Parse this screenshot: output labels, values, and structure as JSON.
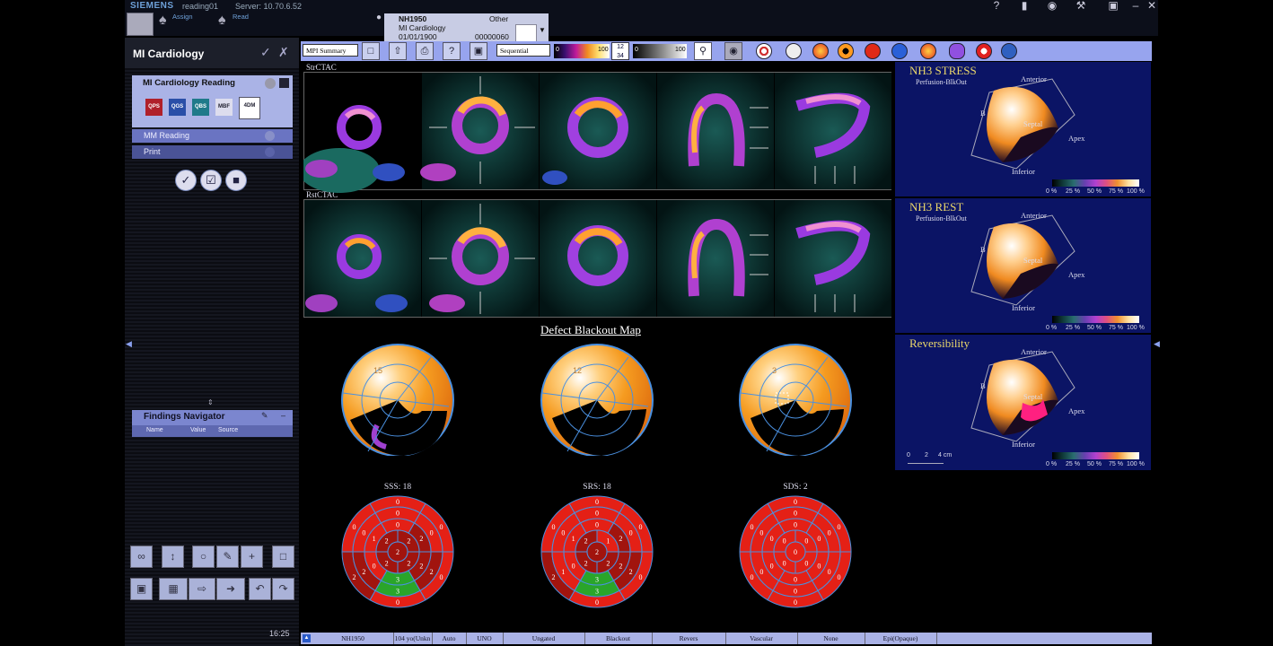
{
  "topbar": {
    "brand": "SIEMENS",
    "user": "reading01",
    "server": "Server: 10.70.6.52",
    "assign": "Assign",
    "read": "Read",
    "patient": {
      "id": "NH1950",
      "type": "Other",
      "workflow": "MI Cardiology",
      "dob": "01/01/1900",
      "number": "00000060"
    }
  },
  "left": {
    "title": "MI Cardiology",
    "task": {
      "label": "MI Cardiology Reading",
      "apps": [
        "QPS",
        "QGS",
        "QBS",
        "MBF",
        "4DM"
      ]
    },
    "rows": [
      "MM Reading",
      "Print"
    ],
    "findings": {
      "title": "Findings Navigator",
      "columns": [
        "Name",
        "Value",
        "Source"
      ]
    },
    "clock": "16:25"
  },
  "toolbar": {
    "layout_select": "MPI Summary",
    "colormap_select": "Sequential",
    "frames": [
      "1",
      "2",
      "3",
      "4"
    ],
    "scale1_min": "0",
    "scale1_max": "100",
    "scale2_min": "0",
    "scale2_max": "100"
  },
  "views": {
    "stress_label": "StrCTAC",
    "rest_label": "RstCTAC",
    "blackout_title": "Defect Blackout Map"
  },
  "blackout_scores": [
    "15",
    "12",
    "3"
  ],
  "scores": {
    "sss": "SSS: 18",
    "srs": "SRS: 18",
    "sds": "SDS: 2"
  },
  "polar_maps": [
    {
      "apex": "2",
      "inner": [
        "2",
        "2",
        "2",
        "2"
      ],
      "mid": [
        "0",
        "2",
        "2",
        "3",
        "0",
        "1"
      ],
      "basal": [
        "0",
        "0",
        "2",
        "3",
        "2",
        "0"
      ],
      "outer": [
        "0",
        "0",
        "0",
        "0",
        "2",
        "0"
      ]
    },
    {
      "apex": "2",
      "inner": [
        "1",
        "2",
        "2",
        "2"
      ],
      "mid": [
        "0",
        "2",
        "2",
        "3",
        "0",
        "1"
      ],
      "basal": [
        "0",
        "0",
        "2",
        "3",
        "1",
        "0"
      ],
      "outer": [
        "0",
        "0",
        "0",
        "0",
        "2",
        "0"
      ]
    },
    {
      "apex": "0",
      "inner": [
        "0",
        "0",
        "0",
        "0"
      ],
      "mid": [
        "0",
        "0",
        "0",
        "0",
        "0",
        "0"
      ],
      "basal": [
        "0",
        "0",
        "0",
        "0",
        "0",
        "0"
      ],
      "outer": [
        "0",
        "0",
        "0",
        "0",
        "0",
        "0"
      ]
    }
  ],
  "panels3d": [
    {
      "title": "NH3 STRESS",
      "sub": "Perfusion-BlkOut",
      "anterior": "Anterior",
      "septal": "Septal",
      "apex": "Apex",
      "inferior": "Inferior",
      "b": "B"
    },
    {
      "title": "NH3 REST",
      "sub": "Perfusion-BlkOut",
      "anterior": "Anterior",
      "septal": "Septal",
      "apex": "Apex",
      "inferior": "Inferior",
      "b": "B"
    },
    {
      "title": "Reversibility",
      "sub": "",
      "anterior": "Anterior",
      "septal": "Septal",
      "apex": "Apex",
      "inferior": "Inferior",
      "b": "B"
    }
  ],
  "scale_labels": [
    "0 %",
    "25 %",
    "50 %",
    "75 %",
    "100 %"
  ],
  "ruler": {
    "l0": "0",
    "l1": "2",
    "l2": "4 cm"
  },
  "status": [
    "NH1950",
    "104 yo(Unkn",
    "Auto",
    "UNO",
    "Ungated",
    "Blackout",
    "Revers",
    "Vascular",
    "None",
    "Epi(Opaque)"
  ],
  "colors": {
    "accent": "#97a4ee",
    "panel3d_bg": "#0b1465",
    "left_bg": "#14161f",
    "polar_red": "#e42016",
    "polar_green": "#2aa52a",
    "polar_dark": "#a1140e"
  }
}
